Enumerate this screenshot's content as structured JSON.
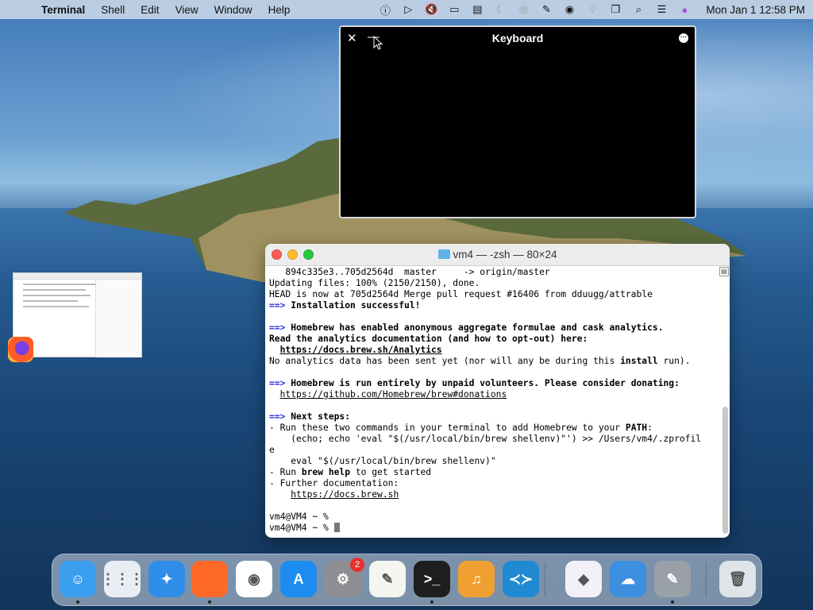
{
  "menubar": {
    "app_name": "Terminal",
    "items": [
      "Shell",
      "Edit",
      "View",
      "Window",
      "Help"
    ],
    "clock": "Mon Jan 1  12:58 PM",
    "status_icons": [
      "accessibility-icon",
      "play-icon",
      "mute-icon",
      "display-icon",
      "sidebar-icon",
      "moon-icon",
      "airdrop-icon",
      "pencil-off-icon",
      "user-icon",
      "wifi-icon",
      "window-icon",
      "search-icon",
      "control-center-icon",
      "siri-icon"
    ]
  },
  "keyboard_window": {
    "title": "Keyboard",
    "close_glyph": "✕",
    "minimize_glyph": "—",
    "more_glyph": "···"
  },
  "terminal": {
    "title": "vm4 — -zsh — 80×24",
    "lines": [
      [
        {
          "t": "   894c335e3..705d2564d  master     -> origin/master"
        }
      ],
      [
        {
          "t": "Updating files: 100% (2150/2150), done."
        }
      ],
      [
        {
          "t": "HEAD is now at 705d2564d Merge pull request #16406 from dduugg/attrable"
        }
      ],
      [
        {
          "t": "==>",
          "c": "arrow-c"
        },
        {
          "t": " Installation successful!",
          "c": "b"
        }
      ],
      [
        {
          "t": ""
        }
      ],
      [
        {
          "t": "==>",
          "c": "arrow-c"
        },
        {
          "t": " Homebrew has enabled anonymous aggregate formulae and cask analytics.",
          "c": "b"
        }
      ],
      [
        {
          "t": "Read the analytics documentation (and how to opt-out) here:",
          "c": "b"
        }
      ],
      [
        {
          "t": "  "
        },
        {
          "t": "https://docs.brew.sh/Analytics",
          "c": "b u"
        }
      ],
      [
        {
          "t": "No analytics data has been sent yet (nor will any be during this "
        },
        {
          "t": "install",
          "c": "b"
        },
        {
          "t": " run)."
        }
      ],
      [
        {
          "t": ""
        }
      ],
      [
        {
          "t": "==>",
          "c": "arrow-c"
        },
        {
          "t": " Homebrew is run entirely by unpaid volunteers. Please consider donating:",
          "c": "b"
        }
      ],
      [
        {
          "t": "  "
        },
        {
          "t": "https://github.com/Homebrew/brew#donations",
          "c": "u"
        }
      ],
      [
        {
          "t": ""
        }
      ],
      [
        {
          "t": "==>",
          "c": "arrow-c"
        },
        {
          "t": " Next steps:",
          "c": "b"
        }
      ],
      [
        {
          "t": "- Run these two commands in your terminal to add Homebrew to your "
        },
        {
          "t": "PATH",
          "c": "b"
        },
        {
          "t": ":"
        }
      ],
      [
        {
          "t": "    (echo; echo 'eval \"$(/usr/local/bin/brew shellenv)\"') >> /Users/vm4/.zprofil"
        }
      ],
      [
        {
          "t": "e"
        }
      ],
      [
        {
          "t": "    eval \"$(/usr/local/bin/brew shellenv)\""
        }
      ],
      [
        {
          "t": "- Run "
        },
        {
          "t": "brew help",
          "c": "b"
        },
        {
          "t": " to get started"
        }
      ],
      [
        {
          "t": "- Further documentation:"
        }
      ],
      [
        {
          "t": "    "
        },
        {
          "t": "https://docs.brew.sh",
          "c": "u"
        }
      ],
      [
        {
          "t": ""
        }
      ],
      [
        {
          "t": "vm4@VM4 ~ %"
        }
      ],
      [
        {
          "t": "vm4@VM4 ~ % "
        },
        {
          "t": "",
          "c": "cursor"
        }
      ]
    ]
  },
  "dock": {
    "apps": [
      {
        "name": "finder",
        "color": "#3b9ff0",
        "glyph": "☺",
        "running": true
      },
      {
        "name": "launchpad",
        "color": "#e9eef5",
        "glyph": "⋮⋮⋮",
        "running": false
      },
      {
        "name": "safari",
        "color": "#2f8fe8",
        "glyph": "✦",
        "running": false
      },
      {
        "name": "firefox",
        "color": "#ff6a2a",
        "glyph": "",
        "running": true
      },
      {
        "name": "chrome",
        "color": "#ffffff",
        "glyph": "◉",
        "running": false
      },
      {
        "name": "app-store",
        "color": "#1d8cf0",
        "glyph": "A",
        "running": false
      },
      {
        "name": "system-preferences",
        "color": "#8e8e93",
        "glyph": "⚙",
        "running": false,
        "badge": "2"
      },
      {
        "name": "textedit",
        "color": "#f5f5f0",
        "glyph": "✎",
        "running": false
      },
      {
        "name": "terminal",
        "color": "#1e1e1e",
        "glyph": ">_",
        "running": true
      },
      {
        "name": "garageband",
        "color": "#f0a030",
        "glyph": "♫",
        "running": false
      },
      {
        "name": "vscode",
        "color": "#1f8ad2",
        "glyph": "≺≻",
        "running": false
      },
      {
        "name": "visual-studio",
        "color": "#f4f0fa",
        "glyph": "◆",
        "running": false
      },
      {
        "name": "weather",
        "color": "#3d8fe0",
        "glyph": "☁",
        "running": false
      },
      {
        "name": "script-editor",
        "color": "#9aa0a8",
        "glyph": "✎",
        "running": true
      },
      {
        "name": "trash",
        "color": "#dfe4ea",
        "glyph": "🗑",
        "running": false
      }
    ]
  }
}
